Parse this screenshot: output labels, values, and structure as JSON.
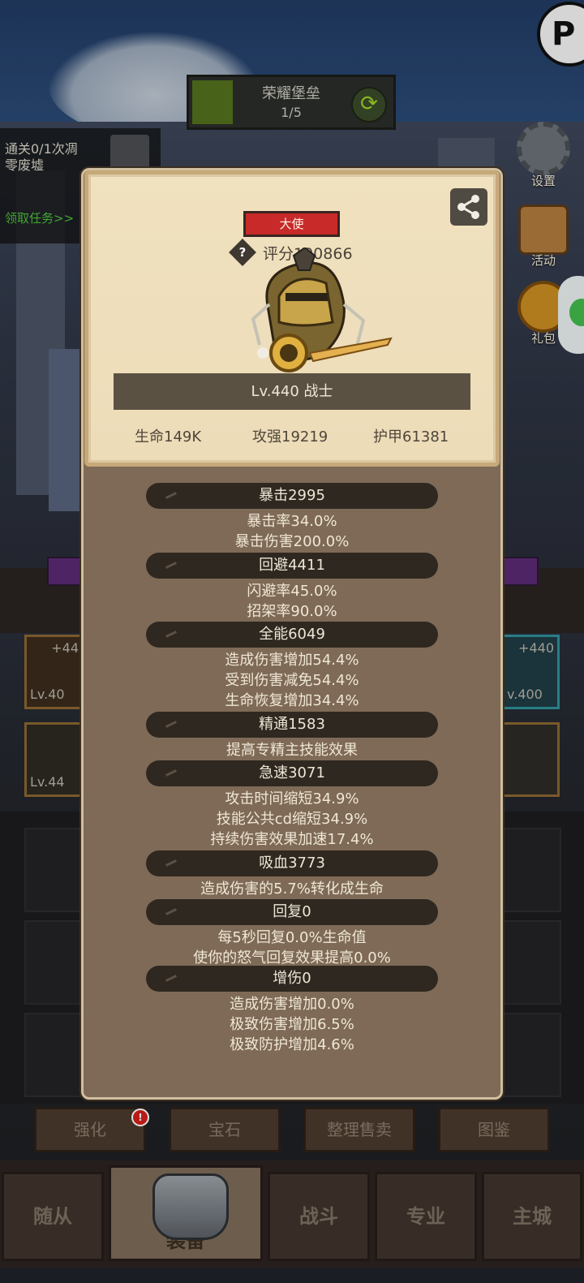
{
  "top_banner": {
    "name": "荣耀堡垒",
    "progress": "1/5"
  },
  "quest": {
    "line1": "通关0/1次凋",
    "line2": "零废墟",
    "link": "领取任务>>"
  },
  "side_buttons": {
    "settings": "设置",
    "activity": "活动",
    "gift": "礼包"
  },
  "slots": [
    {
      "plus": "+44",
      "lv": "Lv.40"
    },
    {
      "plus": "+440",
      "lv": "v.400"
    },
    {
      "plus": "",
      "lv": "Lv.44"
    }
  ],
  "card": {
    "title_tag": "大使",
    "score": "评分100866",
    "level_class": "Lv.440 战士",
    "hp": "生命149K",
    "atk": "攻强19219",
    "armor": "护甲61381"
  },
  "stats": [
    {
      "header": "暴击2995",
      "lines": [
        "暴击率34.0%",
        "暴击伤害200.0%"
      ]
    },
    {
      "header": "回避4411",
      "lines": [
        "闪避率45.0%",
        "招架率90.0%"
      ]
    },
    {
      "header": "全能6049",
      "lines": [
        "造成伤害增加54.4%",
        "受到伤害减免54.4%",
        "生命恢复增加34.4%"
      ]
    },
    {
      "header": "精通1583",
      "lines": [
        "提高专精主技能效果"
      ]
    },
    {
      "header": "急速3071",
      "lines": [
        "攻击时间缩短34.9%",
        "技能公共cd缩短34.9%",
        "持续伤害效果加速17.4%"
      ]
    },
    {
      "header": "吸血3773",
      "lines": [
        "造成伤害的5.7%转化成生命"
      ]
    },
    {
      "header": "回复0",
      "lines": [
        "每5秒回复0.0%生命值",
        "使你的怒气回复效果提高0.0%"
      ]
    },
    {
      "header": "增伤0",
      "lines": [
        "造成伤害增加0.0%",
        "极致伤害增加6.5%",
        "极致防护增加4.6%"
      ]
    }
  ],
  "actions": {
    "enhance": "强化",
    "gem": "宝石",
    "sort_sell": "整理售卖",
    "codex": "图鉴"
  },
  "badge": "!",
  "tabs": {
    "followers": "随从",
    "equipment": "装备",
    "battle": "战斗",
    "profession": "专业",
    "main_city": "主城"
  },
  "colors": {
    "tag_red": "#c82a2a",
    "pill_dark": "#2f2820",
    "panel_brown": "#7e6a56",
    "card_cream": "#f0e1bf",
    "quest_green": "#4cbe3a"
  },
  "icons": {
    "share": "share-icon",
    "help": "question-diamond-icon",
    "cycle": "refresh-icon",
    "gear": "gear-icon"
  }
}
